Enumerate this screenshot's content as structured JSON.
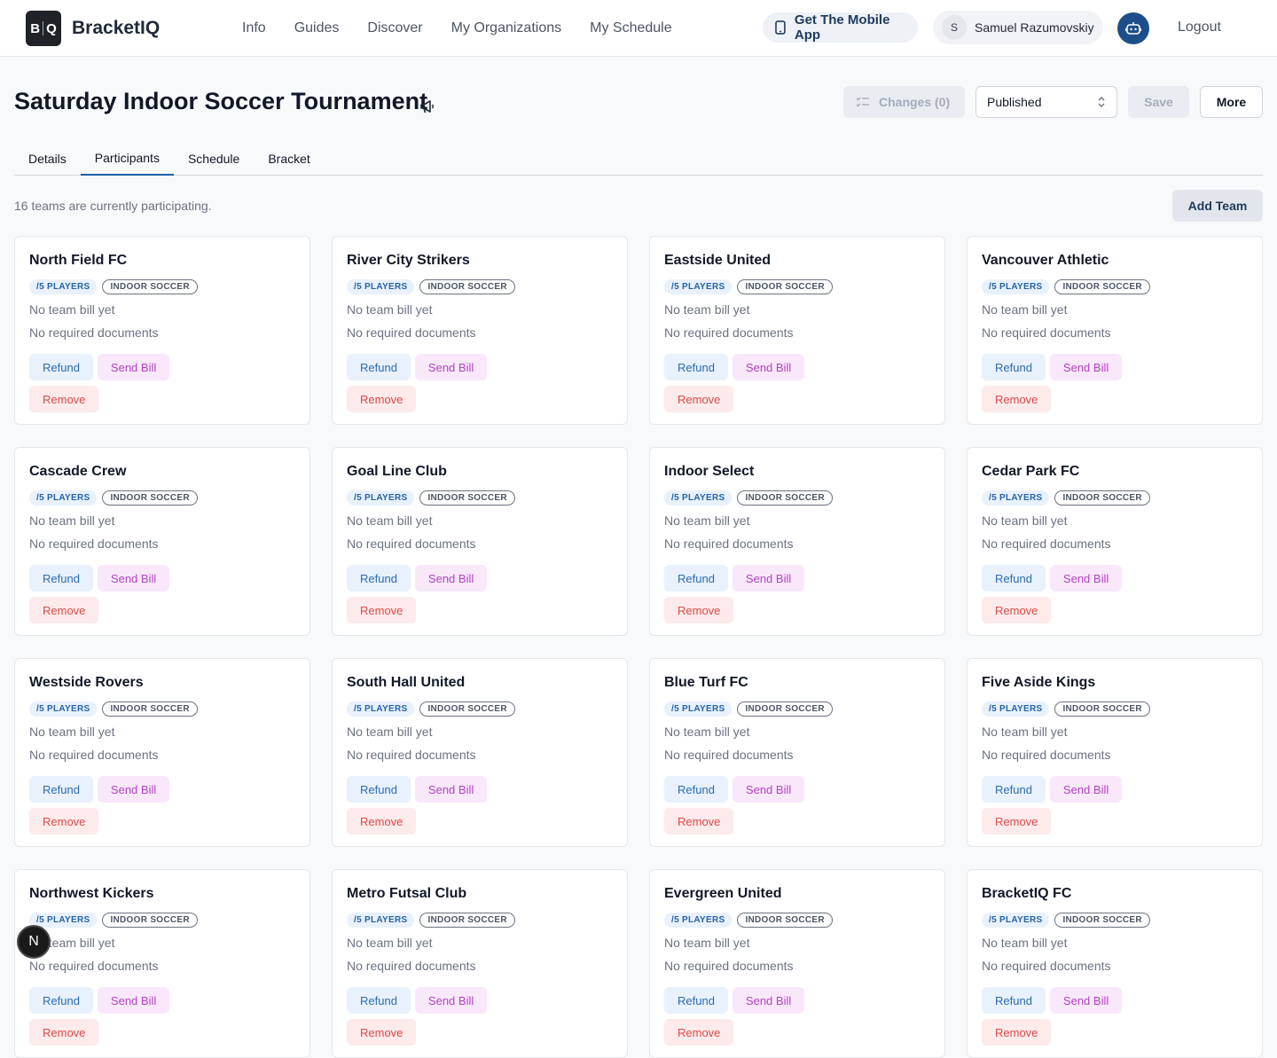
{
  "header": {
    "logo_text": "BracketIQ",
    "logo_mark_left": "B",
    "logo_mark_right": "Q",
    "nav": [
      "Info",
      "Guides",
      "Discover",
      "My Organizations",
      "My Schedule"
    ],
    "mobile_app_label": "Get The Mobile App",
    "user_initial": "S",
    "user_name": "Samuel Razumovskiy",
    "logout_label": "Logout"
  },
  "page": {
    "title": "Saturday Indoor Soccer Tournament",
    "changes_label": "Changes (0)",
    "status_value": "Published",
    "save_label": "Save",
    "more_label": "More"
  },
  "tabs": [
    "Details",
    "Participants",
    "Schedule",
    "Bracket"
  ],
  "active_tab": "Participants",
  "participants": {
    "count_text": "16 teams are currently participating.",
    "add_team_label": "Add Team",
    "teams": [
      {
        "name": "North Field FC",
        "players": "/5 PLAYERS",
        "sport": "INDOOR SOCCER",
        "bill": "No team bill yet",
        "docs": "No required documents"
      },
      {
        "name": "River City Strikers",
        "players": "/5 PLAYERS",
        "sport": "INDOOR SOCCER",
        "bill": "No team bill yet",
        "docs": "No required documents"
      },
      {
        "name": "Eastside United",
        "players": "/5 PLAYERS",
        "sport": "INDOOR SOCCER",
        "bill": "No team bill yet",
        "docs": "No required documents"
      },
      {
        "name": "Vancouver Athletic",
        "players": "/5 PLAYERS",
        "sport": "INDOOR SOCCER",
        "bill": "No team bill yet",
        "docs": "No required documents"
      },
      {
        "name": "Cascade Crew",
        "players": "/5 PLAYERS",
        "sport": "INDOOR SOCCER",
        "bill": "No team bill yet",
        "docs": "No required documents"
      },
      {
        "name": "Goal Line Club",
        "players": "/5 PLAYERS",
        "sport": "INDOOR SOCCER",
        "bill": "No team bill yet",
        "docs": "No required documents"
      },
      {
        "name": "Indoor Select",
        "players": "/5 PLAYERS",
        "sport": "INDOOR SOCCER",
        "bill": "No team bill yet",
        "docs": "No required documents"
      },
      {
        "name": "Cedar Park FC",
        "players": "/5 PLAYERS",
        "sport": "INDOOR SOCCER",
        "bill": "No team bill yet",
        "docs": "No required documents"
      },
      {
        "name": "Westside Rovers",
        "players": "/5 PLAYERS",
        "sport": "INDOOR SOCCER",
        "bill": "No team bill yet",
        "docs": "No required documents"
      },
      {
        "name": "South Hall United",
        "players": "/5 PLAYERS",
        "sport": "INDOOR SOCCER",
        "bill": "No team bill yet",
        "docs": "No required documents"
      },
      {
        "name": "Blue Turf FC",
        "players": "/5 PLAYERS",
        "sport": "INDOOR SOCCER",
        "bill": "No team bill yet",
        "docs": "No required documents"
      },
      {
        "name": "Five Aside Kings",
        "players": "/5 PLAYERS",
        "sport": "INDOOR SOCCER",
        "bill": "No team bill yet",
        "docs": "No required documents"
      },
      {
        "name": "Northwest Kickers",
        "players": "/5 PLAYERS",
        "sport": "INDOOR SOCCER",
        "bill": "No team bill yet",
        "docs": "No required documents"
      },
      {
        "name": "Metro Futsal Club",
        "players": "/5 PLAYERS",
        "sport": "INDOOR SOCCER",
        "bill": "No team bill yet",
        "docs": "No required documents"
      },
      {
        "name": "Evergreen United",
        "players": "/5 PLAYERS",
        "sport": "INDOOR SOCCER",
        "bill": "No team bill yet",
        "docs": "No required documents"
      },
      {
        "name": "BracketIQ FC",
        "players": "/5 PLAYERS",
        "sport": "INDOOR SOCCER",
        "bill": "No team bill yet",
        "docs": "No required documents"
      }
    ],
    "refund_label": "Refund",
    "send_bill_label": "Send Bill",
    "remove_label": "Remove"
  },
  "floating_badge": "N",
  "icons": {
    "mobile": "phone-icon",
    "bot": "robot-icon",
    "announce": "megaphone-icon",
    "changes": "checklist-icon",
    "select": "chevron-updown-icon"
  },
  "colors": {
    "primary": "#1d4e89",
    "tab_active": "#1f5fa8",
    "refund": "#2b6cb0",
    "bill": "#b342c2",
    "remove": "#dc4a4a"
  }
}
